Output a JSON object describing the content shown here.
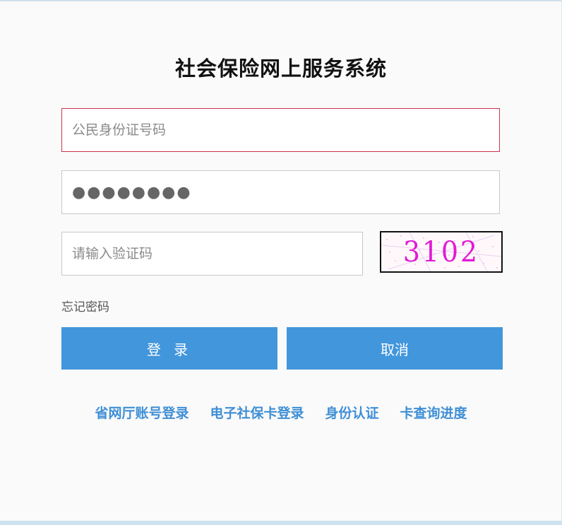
{
  "title": "社会保险网上服务系统",
  "form": {
    "id_placeholder": "公民身份证号码",
    "password_value": "●●●●●●●●",
    "captcha_placeholder": "请输入验证码",
    "captcha_code": "3102"
  },
  "forgot_label": "忘记密码",
  "buttons": {
    "login": "登 录",
    "cancel": "取消"
  },
  "links": [
    {
      "label": "省网厅账号登录"
    },
    {
      "label": "电子社保卡登录"
    },
    {
      "label": "身份认证"
    },
    {
      "label": "卡查询进度"
    }
  ],
  "colors": {
    "accent": "#4296dc",
    "link": "#3f8fd6",
    "active_border": "#d0344b",
    "captcha_text": "#e21ad6"
  }
}
